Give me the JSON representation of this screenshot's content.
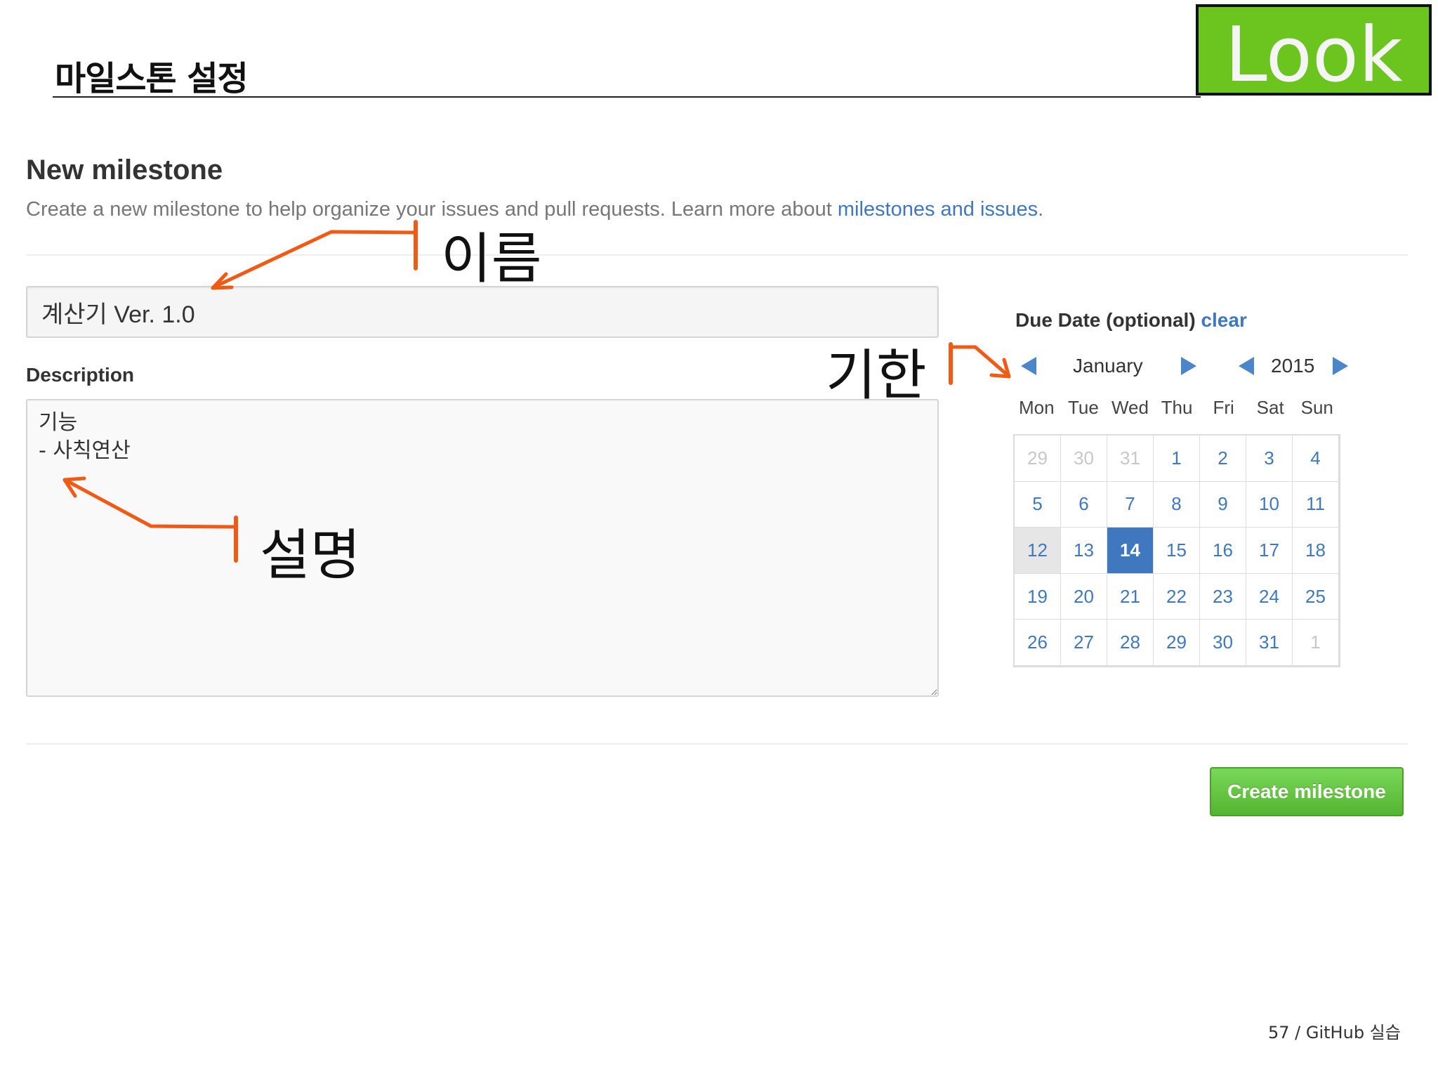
{
  "slide": {
    "title": "마일스톤 설정",
    "badge": "Look",
    "footer": "57 / GitHub 실습"
  },
  "form": {
    "heading": "New milestone",
    "subtitle_text": "Create a new milestone to help organize your issues and pull requests. Learn more about ",
    "subtitle_link": "milestones and issues",
    "subtitle_end": ".",
    "title_value": "계산기 Ver. 1.0",
    "description_label": "Description",
    "description_value": "기능\n- 사칙연산",
    "create_button": "Create milestone"
  },
  "due_date": {
    "label": "Due Date (optional)",
    "clear": "clear",
    "month": "January",
    "year": "2015",
    "weekdays": [
      "Mon",
      "Tue",
      "Wed",
      "Thu",
      "Fri",
      "Sat",
      "Sun"
    ],
    "weeks": [
      [
        "29",
        "30",
        "31",
        "1",
        "2",
        "3",
        "4"
      ],
      [
        "5",
        "6",
        "7",
        "8",
        "9",
        "10",
        "11"
      ],
      [
        "12",
        "13",
        "14",
        "15",
        "16",
        "17",
        "18"
      ],
      [
        "19",
        "20",
        "21",
        "22",
        "23",
        "24",
        "25"
      ],
      [
        "26",
        "27",
        "28",
        "29",
        "30",
        "31",
        "1"
      ]
    ],
    "selected_day": "14",
    "today_day": "12"
  },
  "annotations": {
    "name": "이름",
    "due": "기한",
    "description": "설명",
    "color": "#f05a14"
  },
  "colors": {
    "badge": "#6cc41f",
    "link": "#4078c0",
    "button": "#55b431"
  }
}
